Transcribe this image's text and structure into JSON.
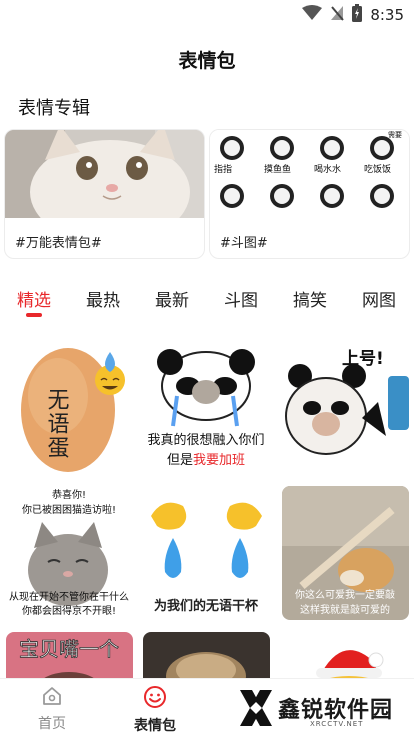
{
  "status_bar": {
    "time": "8:35"
  },
  "header": {
    "title": "表情包"
  },
  "albums": {
    "section_title": "表情专辑",
    "items": [
      {
        "caption": "#万能表情包#"
      },
      {
        "caption": "#斗图#",
        "thumb_texts": [
          "指指",
          "摸鱼鱼",
          "喝水水",
          "吃饭饭",
          "需要"
        ]
      }
    ]
  },
  "tabs": [
    {
      "label": "精选",
      "active": true
    },
    {
      "label": "最热"
    },
    {
      "label": "最新"
    },
    {
      "label": "斗图"
    },
    {
      "label": "搞笑"
    },
    {
      "label": "网图"
    }
  ],
  "memes": {
    "egg": "无语蛋",
    "panda_line1": "我真的很想融入你们",
    "panda_line2_prefix": "但是",
    "panda_line2_highlight": "我要加班",
    "shanghao": "上号!",
    "cat_top1": "恭喜你!",
    "cat_top2": "你已被困困猫造访啦!",
    "cat_bottom1": "从现在开始不管你在干什么",
    "cat_bottom2": "你都会困得京不开眼!",
    "hands_caption": "为我们的无语干杯",
    "doge_line1": "你这么可爱我一定要敲",
    "doge_line2": "这样我就是敲可爱的",
    "baby": "宝贝嘴一个"
  },
  "bottom_nav": [
    {
      "label": "首页",
      "icon": "home-icon"
    },
    {
      "label": "表情包",
      "icon": "smile-icon",
      "active": true
    }
  ],
  "watermark": {
    "brand": "鑫锐软件园",
    "sub": "XRCCTV.NET"
  },
  "colors": {
    "accent": "#e8282b",
    "inactive": "#8a8a8a"
  }
}
